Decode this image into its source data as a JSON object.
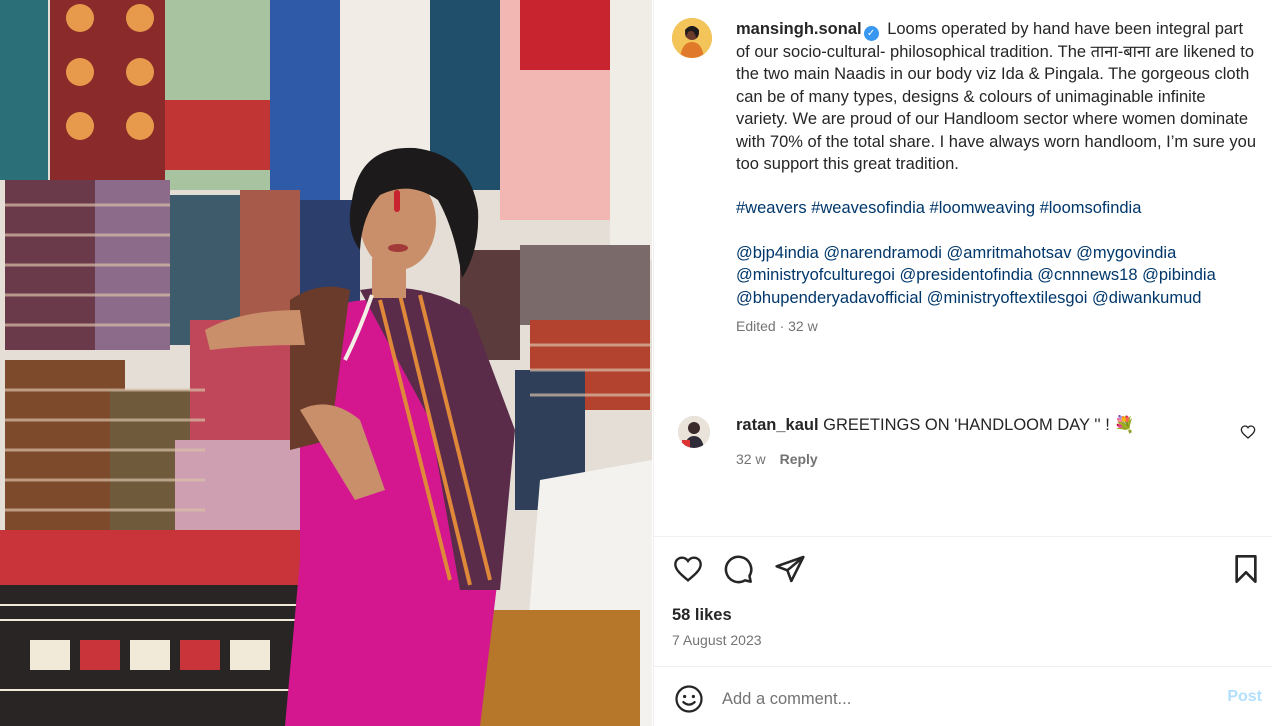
{
  "post": {
    "username": "mansingh.sonal",
    "caption_text": "Looms operated by hand have been integral part of our socio-cultural- philosophical tradition. The ताना-बाना are likened to the two main Naadis in our body viz Ida & Pingala. The gorgeous cloth can be of many types, designs & colours of unimaginable infinite variety. We are proud of our Handloom sector where women dominate with 70% of the total share. I have always worn handloom, I’m sure you too support this great tradition.",
    "hashtags": "#weavers #weavesofindia #loomweaving #loomsofindia",
    "mentions": "@bjp4india @narendramodi @amritmahotsav @mygovindia @ministryofculturegoi @presidentofindia @cnnnews18 @pibindia @bhupenderyadavofficial @ministryoftextilesgoi @diwankumud",
    "edited": "Edited · 32 w",
    "likes": "58 likes",
    "date": "7 August 2023"
  },
  "comment": {
    "username": "ratan_kaul",
    "text": "GREETINGS ON 'HANDLOOM DAY '' ! 💐",
    "age": "32 w",
    "reply": "Reply"
  },
  "add_comment": {
    "placeholder": "Add a comment...",
    "post": "Post"
  },
  "icons": {
    "verified": "verified-badge-icon",
    "like": "heart-icon",
    "comment": "comment-bubble-icon",
    "share": "send-paper-plane-icon",
    "save": "bookmark-icon",
    "emoji": "emoji-smiley-icon"
  },
  "colors": {
    "link": "#00376b",
    "muted": "#737373",
    "verified": "#3897f0",
    "post_disabled": "#b2dffc",
    "saree_pink": "#d4178f"
  }
}
